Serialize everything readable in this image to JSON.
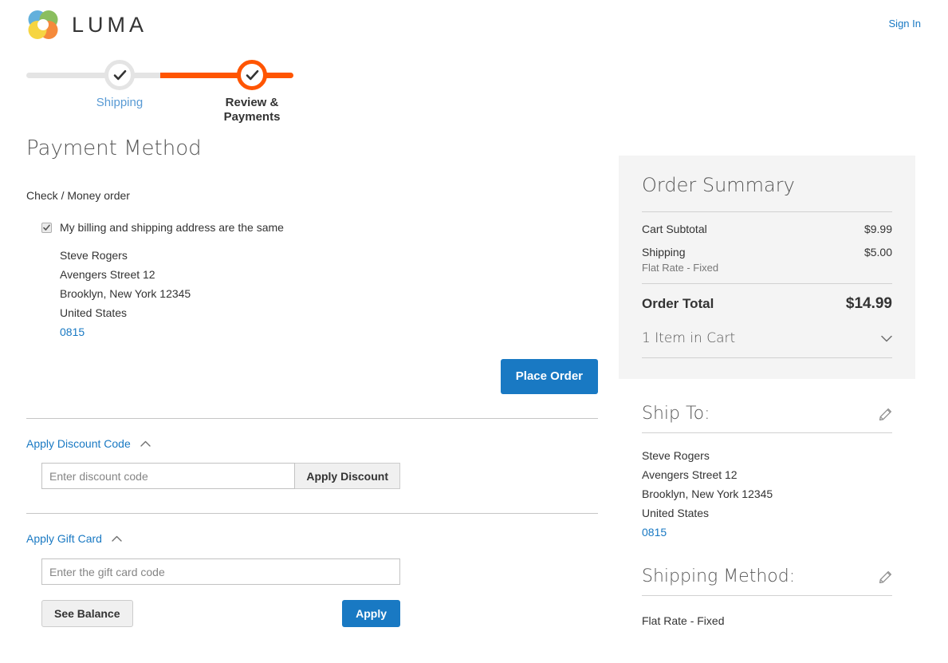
{
  "header": {
    "brand": "LUMA",
    "logo_icon": "luma-ring-logo",
    "sign_in_label": "Sign In",
    "logo_colors": {
      "blue": "#4da6d8",
      "green": "#7ab648",
      "orange": "#f47b20",
      "yellow": "#f5d029"
    }
  },
  "progress": {
    "steps": [
      {
        "label": "Shipping",
        "state": "completed",
        "icon": "check-icon"
      },
      {
        "label": "Review & Payments",
        "state": "active",
        "icon": "check-icon"
      }
    ],
    "track_color": "#e4e4e4",
    "fill_color": "#ff5501"
  },
  "main": {
    "page_title": "Payment Method",
    "payment_method_name": "Check / Money order",
    "billing_checkbox": {
      "label": "My billing and shipping address are the same",
      "checked": true
    },
    "billing_address": {
      "name": "Steve Rogers",
      "street": "Avengers Street 12",
      "city_state_zip": "Brooklyn, New York 12345",
      "country": "United States",
      "telephone": "0815"
    },
    "place_order_label": "Place Order",
    "discount": {
      "toggle_label": "Apply Discount Code",
      "toggle_icon": "chevron-up-icon",
      "input_value": "",
      "input_placeholder": "Enter discount code",
      "apply_label": "Apply Discount"
    },
    "giftcard": {
      "toggle_label": "Apply Gift Card",
      "toggle_icon": "chevron-up-icon",
      "input_value": "",
      "input_placeholder": "Enter the gift card code",
      "see_balance_label": "See Balance",
      "apply_label": "Apply"
    }
  },
  "sidebar": {
    "summary": {
      "title": "Order Summary",
      "rows": [
        {
          "label": "Cart Subtotal",
          "value": "$9.99",
          "sub": ""
        },
        {
          "label": "Shipping",
          "value": "$5.00",
          "sub": "Flat Rate - Fixed"
        }
      ],
      "total_label": "Order Total",
      "total_value": "$14.99",
      "items_label": "1 Item in Cart",
      "items_icon": "chevron-down-icon"
    },
    "ship_to": {
      "title": "Ship To:",
      "edit_icon": "pencil-icon",
      "name": "Steve Rogers",
      "street": "Avengers Street 12",
      "city_state_zip": "Brooklyn, New York 12345",
      "country": "United States",
      "telephone": "0815"
    },
    "shipping_method": {
      "title": "Shipping Method:",
      "edit_icon": "pencil-icon",
      "value": "Flat Rate - Fixed"
    }
  },
  "colors": {
    "accent_blue": "#1979c3",
    "accent_orange": "#ff5501",
    "panel_gray": "#f4f4f4",
    "text": "#333333"
  }
}
